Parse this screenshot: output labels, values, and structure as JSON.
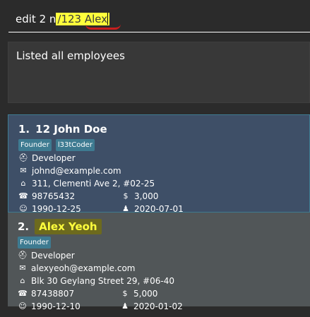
{
  "command": {
    "prefix": "edit 2 n",
    "highlighted": "/123 Alex"
  },
  "result": {
    "message": "Listed all employees"
  },
  "employees": [
    {
      "index": "1.",
      "name": "12 John Doe",
      "tags": [
        "Founder",
        "l33tCoder"
      ],
      "role": "Developer",
      "email": "johnd@example.com",
      "address": "311, Clementi Ave 2, #02-25",
      "phone": "98765432",
      "salary": "3,000",
      "birthday": "1990-12-25",
      "join_date": "2020-07-01"
    },
    {
      "index": "2.",
      "name": "Alex Yeoh",
      "tags": [
        "Founder"
      ],
      "role": "Developer",
      "email": "alexyeoh@example.com",
      "address": "Blk 30 Geylang Street 29, #06-40",
      "phone": "87438807",
      "salary": "5,000",
      "birthday": "1990-12-10",
      "join_date": "2020-01-02"
    }
  ],
  "icons": {
    "role": "role-icon",
    "email": "email-icon",
    "address": "home-icon",
    "phone": "phone-icon",
    "salary": "dollar-icon",
    "birthday": "birthday-icon",
    "join_date": "person-icon"
  }
}
